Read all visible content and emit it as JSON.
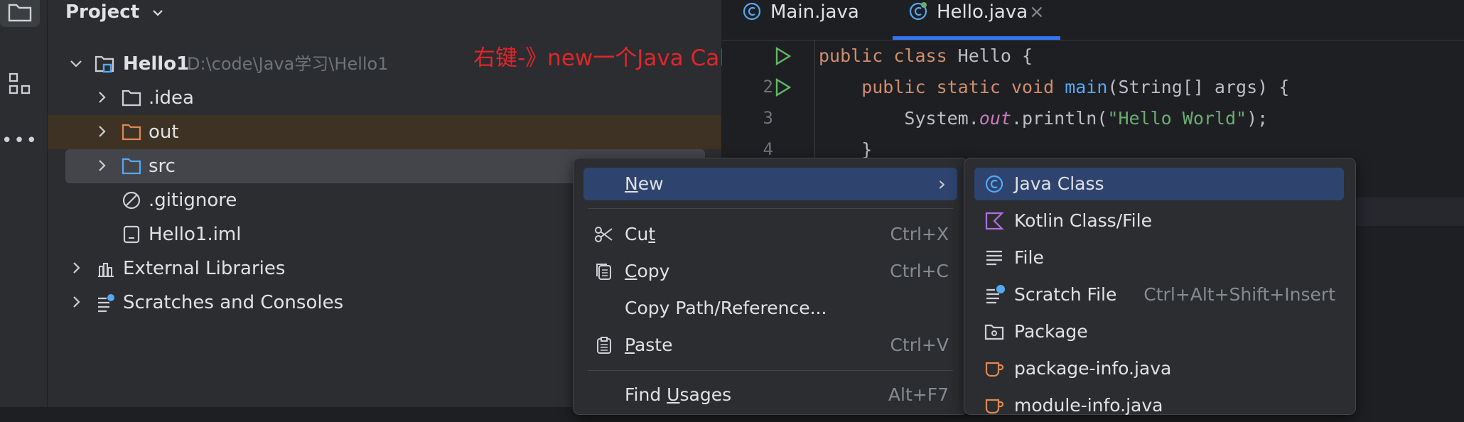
{
  "toolstrip": {
    "items": [
      {
        "icon": "folder-icon"
      },
      {
        "icon": "structure-icon"
      },
      {
        "icon": "more-icon",
        "label": "•••"
      }
    ]
  },
  "project": {
    "title": "Project",
    "tree": [
      {
        "label": "Hello1",
        "path": "D:\\code\\Java学习\\Hello1",
        "icon": "module-icon",
        "expanded": true
      },
      {
        "label": ".idea",
        "icon": "folder-icon"
      },
      {
        "label": "out",
        "icon": "folder-icon"
      },
      {
        "label": "src",
        "icon": "folder-icon"
      },
      {
        "label": ".gitignore",
        "icon": "ignore-icon"
      },
      {
        "label": "Hello1.iml",
        "icon": "file-icon"
      },
      {
        "label": "External Libraries",
        "icon": "library-icon"
      },
      {
        "label": "Scratches and Consoles",
        "icon": "scratches-icon"
      }
    ],
    "annotation": "右键-》new一个Java Calass"
  },
  "editor": {
    "tabs": [
      {
        "label": "Main.java",
        "active": false
      },
      {
        "label": "Hello.java",
        "active": true,
        "close": "×"
      }
    ],
    "lines": [
      {
        "num": "",
        "parts": [
          "public ",
          "class ",
          "Hello {"
        ]
      },
      {
        "num": "2",
        "parts": [
          "    public ",
          "static ",
          "void ",
          "main",
          "(String[] args) {"
        ]
      },
      {
        "num": "3",
        "parts": [
          "        System.",
          "out",
          ".println(",
          "\"Hello World\"",
          ");"
        ]
      },
      {
        "num": "4",
        "parts": [
          "    }"
        ]
      }
    ]
  },
  "context_menu": {
    "items": [
      {
        "label": "New",
        "mnemonic": "N",
        "rest": "ew",
        "arrow": "›"
      },
      {
        "label_pre": "Cu",
        "mnemonic": "t",
        "label_post": "",
        "shortcut": "Ctrl+X",
        "icon": "scissors-icon"
      },
      {
        "label_pre": "",
        "mnemonic": "C",
        "label_post": "opy",
        "shortcut": "Ctrl+C",
        "icon": "copy-icon"
      },
      {
        "label": "Copy Path/Reference..."
      },
      {
        "label_pre": "",
        "mnemonic": "P",
        "label_post": "aste",
        "shortcut": "Ctrl+V",
        "icon": "paste-icon"
      },
      {
        "label_pre": "Find ",
        "mnemonic": "U",
        "label_post": "sages",
        "shortcut": "Alt+F7"
      }
    ]
  },
  "new_submenu": {
    "items": [
      {
        "label": "Java Class",
        "icon": "java-class-icon"
      },
      {
        "label": "Kotlin Class/File",
        "icon": "kotlin-icon"
      },
      {
        "label": "File",
        "icon": "file-lines-icon"
      },
      {
        "label": "Scratch File",
        "shortcut": "Ctrl+Alt+Shift+Insert",
        "icon": "scratch-file-icon"
      },
      {
        "label": "Package",
        "icon": "package-icon"
      },
      {
        "label": "package-info.java",
        "icon": "package-info-icon"
      },
      {
        "label": "module-info.java",
        "icon": "module-info-icon"
      }
    ]
  },
  "colors": {
    "keyword": "#cf8e6d",
    "method": "#56a8f5",
    "string": "#6aab73",
    "field": "#c77dbb",
    "annotation": "#e0262a",
    "selection": "#2e436e"
  }
}
